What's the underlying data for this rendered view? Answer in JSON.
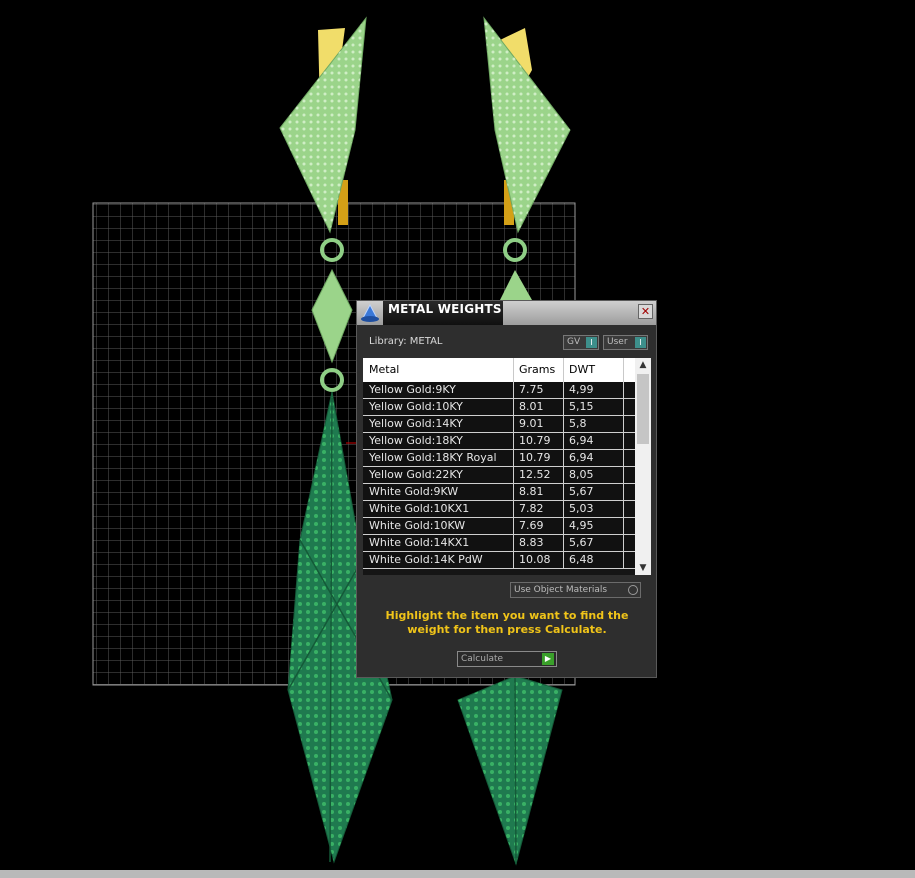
{
  "panel": {
    "title": "METAL WEIGHTS",
    "close_label": "✕",
    "library_label": "Library: METAL",
    "gv_label": "GV",
    "user_label": "User",
    "toggle_glyph": "I",
    "table": {
      "headers": [
        "Metal",
        "Grams",
        "DWT"
      ],
      "rows": [
        {
          "metal": "Yellow Gold:9KY",
          "grams": "7.75",
          "dwt": "4,99"
        },
        {
          "metal": "Yellow Gold:10KY",
          "grams": "8.01",
          "dwt": "5,15"
        },
        {
          "metal": "Yellow Gold:14KY",
          "grams": "9.01",
          "dwt": "5,8"
        },
        {
          "metal": "Yellow Gold:18KY",
          "grams": "10.79",
          "dwt": "6,94"
        },
        {
          "metal": "Yellow Gold:18KY Royal",
          "grams": "10.79",
          "dwt": "6,94"
        },
        {
          "metal": "Yellow Gold:22KY",
          "grams": "12.52",
          "dwt": "8,05"
        },
        {
          "metal": "White Gold:9KW",
          "grams": "8.81",
          "dwt": "5,67"
        },
        {
          "metal": "White Gold:10KX1",
          "grams": "7.82",
          "dwt": "5,03"
        },
        {
          "metal": "White Gold:10KW",
          "grams": "7.69",
          "dwt": "4,95"
        },
        {
          "metal": "White Gold:14KX1",
          "grams": "8.83",
          "dwt": "5,67"
        },
        {
          "metal": "White Gold:14K PdW",
          "grams": "10.08",
          "dwt": "6,48"
        }
      ]
    },
    "use_object_label": "Use Object Materials",
    "instruction": "Highlight the item you want to find the weight for then press Calculate.",
    "calculate_label": "Calculate",
    "calculate_glyph": "▶"
  },
  "scroll": {
    "up": "▲",
    "down": "▼"
  },
  "colors": {
    "accent_yellow": "#f0c419",
    "toggle_teal": "#3d8f8b",
    "go_green": "#3aa02a",
    "gem_light": "#a8e0a0",
    "gem_dark": "#1f7a4f"
  }
}
